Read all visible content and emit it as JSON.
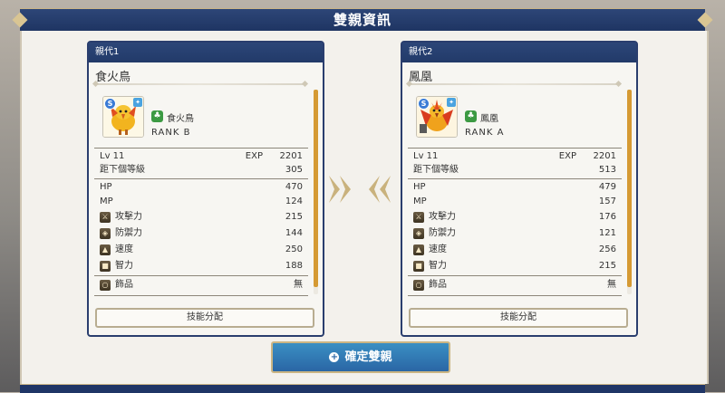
{
  "title": "雙親資訊",
  "confirm_button": "確定雙親",
  "parents": [
    {
      "slot": "親代1",
      "name": "食火鳥",
      "species": "食火鳥",
      "rank": "RANK  B",
      "rarity": "S",
      "lv_label": "Lv 11",
      "exp_label": "EXP",
      "exp": "2201",
      "next_label": "距下個等級",
      "next": "305",
      "stats": [
        {
          "label": "HP",
          "value": "470"
        },
        {
          "label": "MP",
          "value": "124"
        }
      ],
      "attrs": [
        {
          "icon": "sword-icon",
          "label": "攻擊力",
          "value": "215"
        },
        {
          "icon": "shield-icon",
          "label": "防禦力",
          "value": "144"
        },
        {
          "icon": "boot-icon",
          "label": "速度",
          "value": "250"
        },
        {
          "icon": "book-icon",
          "label": "智力",
          "value": "188"
        }
      ],
      "accessory_label": "飾品",
      "accessory": "無",
      "skill_button": "技能分配"
    },
    {
      "slot": "親代2",
      "name": "鳳凰",
      "species": "鳳凰",
      "rank": "RANK  A",
      "rarity": "S",
      "lv_label": "Lv 11",
      "exp_label": "EXP",
      "exp": "2201",
      "next_label": "距下個等級",
      "next": "513",
      "stats": [
        {
          "label": "HP",
          "value": "479"
        },
        {
          "label": "MP",
          "value": "157"
        }
      ],
      "attrs": [
        {
          "icon": "sword-icon",
          "label": "攻擊力",
          "value": "176"
        },
        {
          "icon": "shield-icon",
          "label": "防禦力",
          "value": "121"
        },
        {
          "icon": "boot-icon",
          "label": "速度",
          "value": "256"
        },
        {
          "icon": "book-icon",
          "label": "智力",
          "value": "215"
        }
      ],
      "accessory_label": "飾品",
      "accessory": "無",
      "skill_button": "技能分配"
    }
  ],
  "colors": {
    "frame": "#2a3e6e",
    "accent": "#d59a34",
    "button": "#2a66a5"
  }
}
